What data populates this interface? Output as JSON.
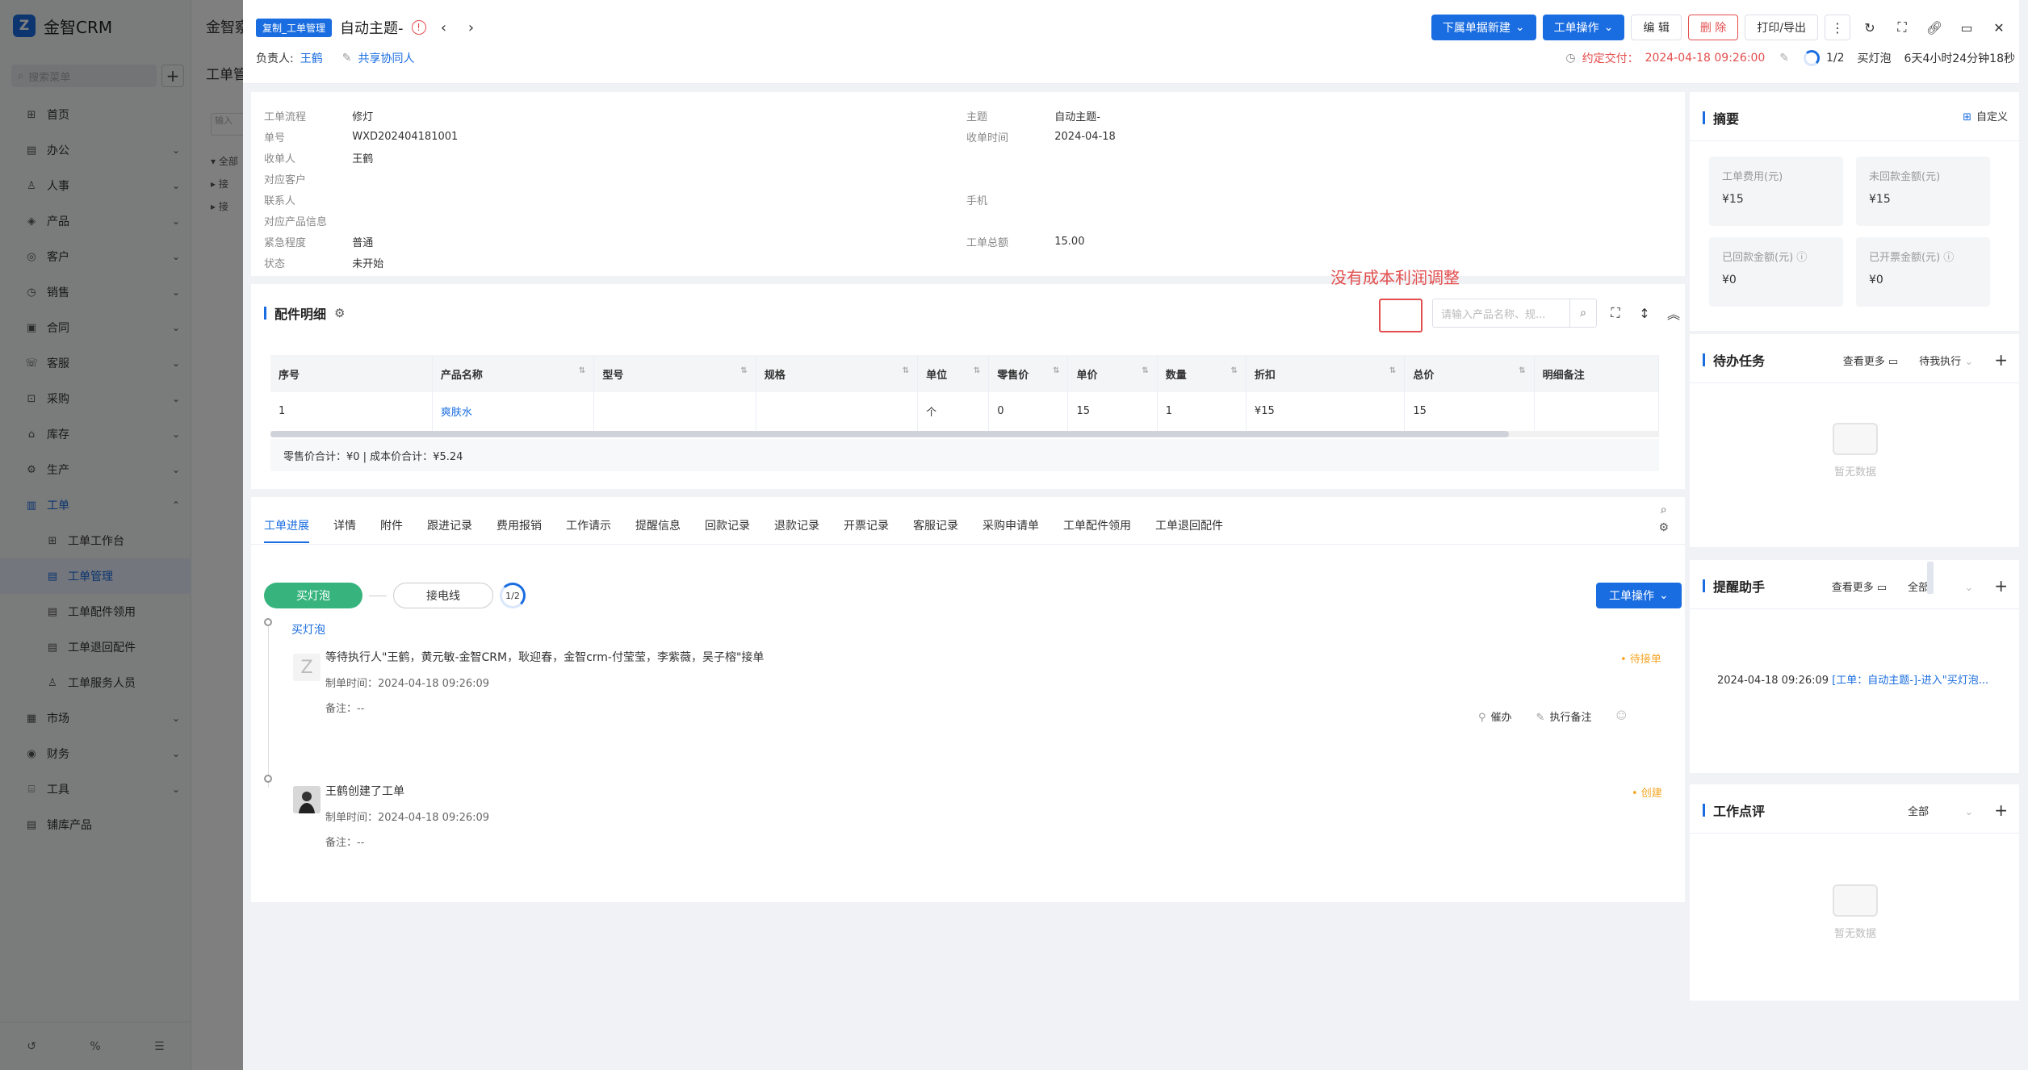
{
  "app": {
    "name": "金智CRM",
    "logo_letter": "Z"
  },
  "sidebar": {
    "search_placeholder": "搜索菜单",
    "items": [
      {
        "label": "首页",
        "icon": "home-icon",
        "chev": ""
      },
      {
        "label": "办公",
        "icon": "office-icon",
        "chev": "⌄"
      },
      {
        "label": "人事",
        "icon": "people-icon",
        "chev": "⌄"
      },
      {
        "label": "产品",
        "icon": "product-icon",
        "chev": "⌄"
      },
      {
        "label": "客户",
        "icon": "customer-icon",
        "chev": "⌄"
      },
      {
        "label": "销售",
        "icon": "sales-icon",
        "chev": "⌄"
      },
      {
        "label": "合同",
        "icon": "contract-icon",
        "chev": "⌄"
      },
      {
        "label": "客服",
        "icon": "service-icon",
        "chev": "⌄"
      },
      {
        "label": "采购",
        "icon": "purchase-icon",
        "chev": "⌄"
      },
      {
        "label": "库存",
        "icon": "stock-icon",
        "chev": "⌄"
      },
      {
        "label": "生产",
        "icon": "production-icon",
        "chev": "⌄"
      },
      {
        "label": "工单",
        "icon": "workorder-icon",
        "chev": "⌃"
      }
    ],
    "sub_items": [
      {
        "label": "工单工作台"
      },
      {
        "label": "工单管理"
      },
      {
        "label": "工单配件领用"
      },
      {
        "label": "工单退回配件"
      },
      {
        "label": "工单服务人员"
      }
    ],
    "items_after": [
      {
        "label": "市场",
        "chev": "⌄"
      },
      {
        "label": "财务",
        "chev": "⌄"
      },
      {
        "label": "工具",
        "chev": "⌄"
      },
      {
        "label": "铺库产品",
        "chev": ""
      }
    ]
  },
  "midpeek": {
    "title": "金智察",
    "sub": "工单管",
    "input_placeholder": "输入",
    "tree": [
      "▾ 全部",
      "  ▸ 接",
      "  ▸ 接"
    ]
  },
  "header": {
    "copy_tag": "复制_工单管理",
    "title": "自动主题-",
    "owner_label": "负责人:",
    "owner": "王鹤",
    "share": "共享协同人",
    "btn_sub_create": "下属单据新建",
    "btn_ops": "工单操作",
    "btn_edit": "编 辑",
    "btn_delete": "删 除",
    "btn_print": "打印/导出",
    "due_label": "约定交付：",
    "due_value": "2024-04-18 09:26:00",
    "progress": "1/2",
    "stage": "买灯泡",
    "elapsed": "6天4小时24分钟18秒"
  },
  "info": {
    "left": [
      {
        "k": "工单流程",
        "v": "修灯"
      },
      {
        "k": "单号",
        "v": "WXD202404181001"
      },
      {
        "k": "收单人",
        "v": "王鹤"
      },
      {
        "k": "对应客户",
        "v": ""
      },
      {
        "k": "联系人",
        "v": ""
      },
      {
        "k": "对应产品信息",
        "v": ""
      },
      {
        "k": "紧急程度",
        "v": "普通"
      },
      {
        "k": "状态",
        "v": "未开始"
      }
    ],
    "right": [
      {
        "k": "主题",
        "v": "自动主题-"
      },
      {
        "k": "收单时间",
        "v": "2024-04-18"
      },
      {
        "k": "",
        "v": ""
      },
      {
        "k": "",
        "v": ""
      },
      {
        "k": "手机",
        "v": ""
      },
      {
        "k": "",
        "v": ""
      },
      {
        "k": "工单总额",
        "v": "15.00"
      },
      {
        "k": "",
        "v": ""
      }
    ]
  },
  "parts": {
    "title": "配件明细",
    "annotation": "没有成本利润调整",
    "search_placeholder": "请输入产品名称、规...",
    "columns": [
      "序号",
      "产品名称",
      "型号",
      "规格",
      "单位",
      "零售价",
      "单价",
      "数量",
      "折扣",
      "总价",
      "明细备注"
    ],
    "rows": [
      [
        "1",
        "爽肤水",
        "",
        "",
        "个",
        "0",
        "15",
        "1",
        "¥15",
        "15",
        ""
      ]
    ],
    "summary": "零售价合计：¥0 |   成本价合计：¥5.24"
  },
  "tabs": {
    "items": [
      "工单进展",
      "详情",
      "附件",
      "跟进记录",
      "费用报销",
      "工作请示",
      "提醒信息",
      "回款记录",
      "退款记录",
      "开票记录",
      "客服记录",
      "采购申请单",
      "工单配件领用",
      "工单退回配件"
    ],
    "step1": "买灯泡",
    "step2": "接电线",
    "ring": "1/2",
    "op_btn": "工单操作",
    "node1_name": "买灯泡",
    "entry1": {
      "title": "等待执行人\"王鹤，黄元敏-金智CRM，耿迎春，金智crm-付莹莹，李紫薇，吴子榕\"接单",
      "time": "制单时间：2024-04-18 09:26:09",
      "note": "备注：--",
      "badge": "• 待接单",
      "urge": "催办",
      "exec_note": "执行备注"
    },
    "entry2": {
      "title": "王鹤创建了工单",
      "time": "制单时间：2024-04-18 09:26:09",
      "note": "备注：--",
      "badge": "• 创建"
    }
  },
  "summary_panel": {
    "title": "摘要",
    "custom": "自定义",
    "metrics": [
      {
        "label": "工单费用(元)",
        "value": "¥15"
      },
      {
        "label": "未回款金额(元)",
        "value": "¥15"
      },
      {
        "label": "已回款金额(元)",
        "value": "¥0"
      },
      {
        "label": "已开票金额(元)",
        "value": "¥0"
      }
    ]
  },
  "todo": {
    "title": "待办任务",
    "more": "查看更多",
    "filter": "待我执行",
    "empty": "暂无数据"
  },
  "reminder": {
    "title": "提醒助手",
    "more": "查看更多",
    "filter": "全部",
    "time": "2024-04-18 09:26:09",
    "link": "[工单：自动主题-]-进入\"买灯泡..."
  },
  "review": {
    "title": "工作点评",
    "filter": "全部",
    "empty": "暂无数据"
  },
  "colors": {
    "primary": "#1a6de0",
    "danger": "#e34d4d",
    "success": "#37b47e",
    "warning": "#f5a623"
  }
}
